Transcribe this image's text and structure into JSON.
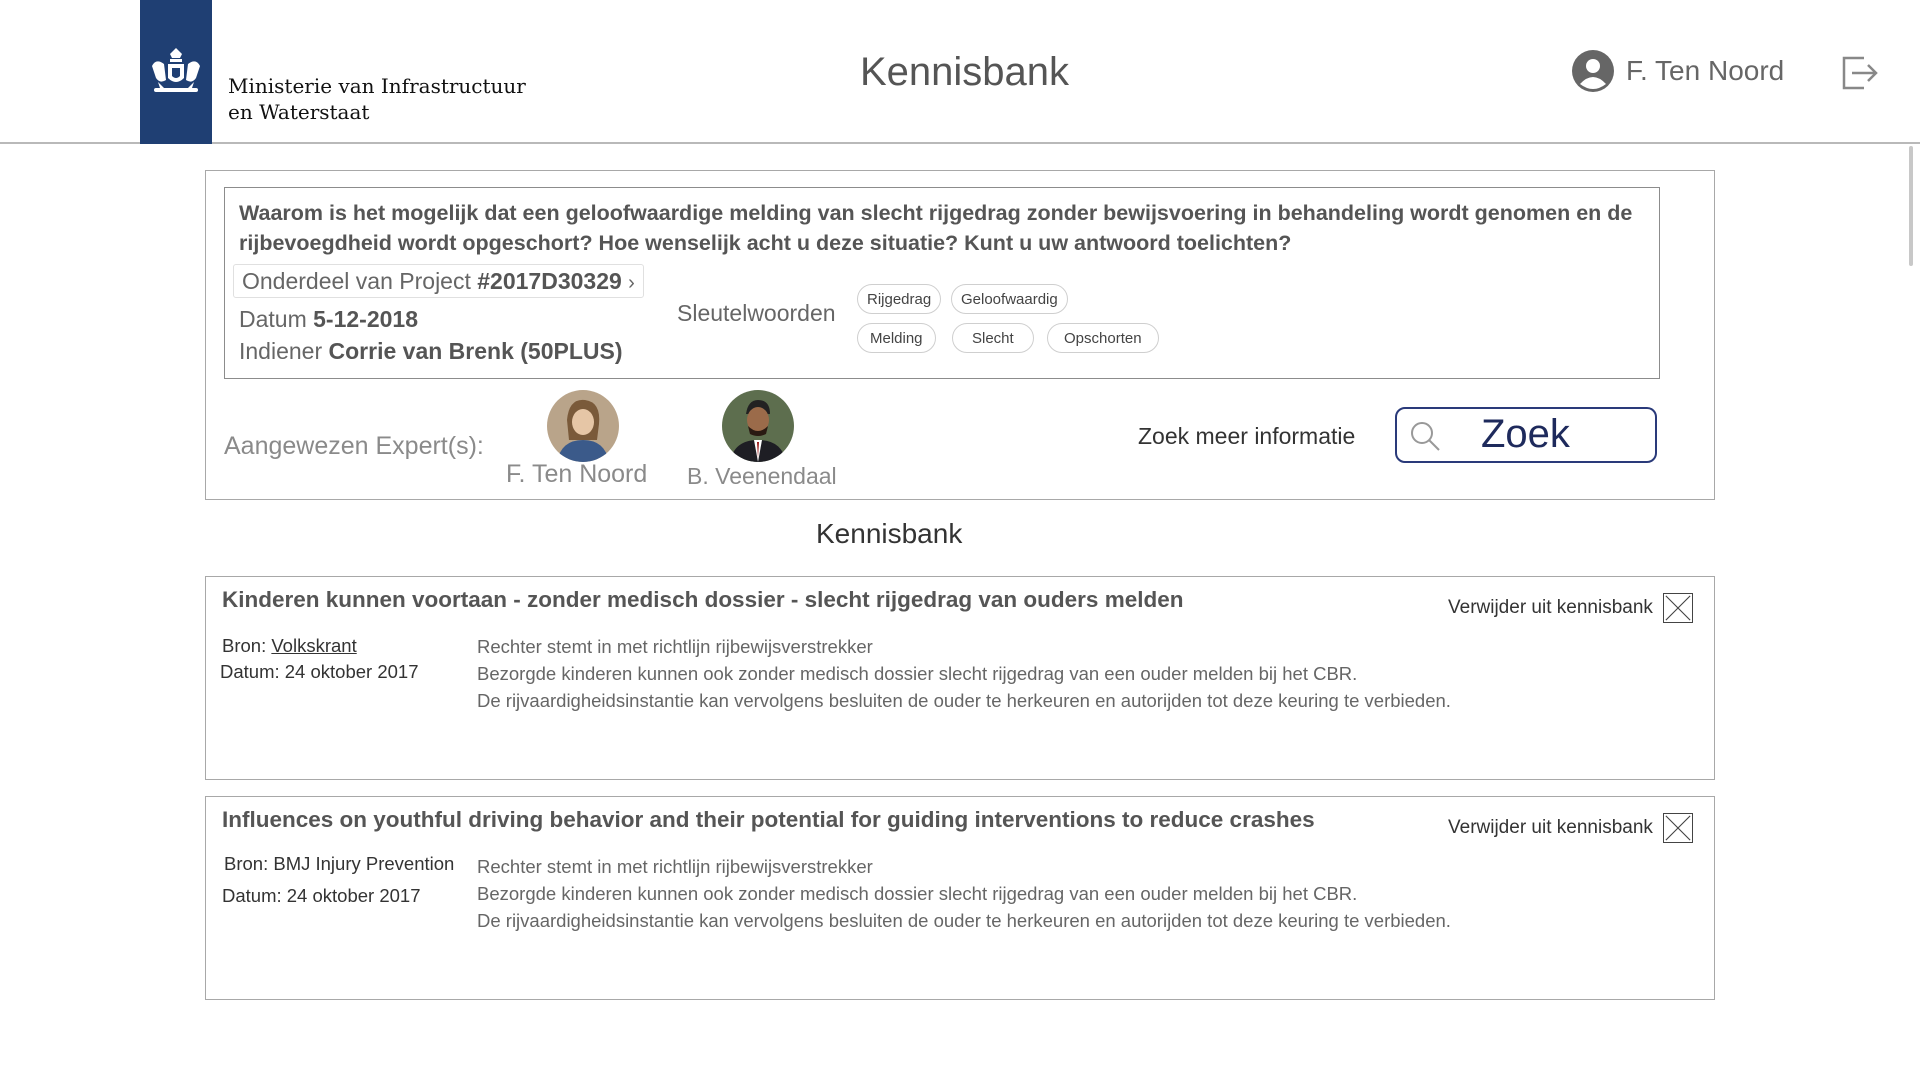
{
  "header": {
    "ministry_line1": "Ministerie van Infrastructuur",
    "ministry_line2": "en Waterstaat",
    "app_title": "Kennisbank",
    "user_name": "F. Ten Noord",
    "brand_color": "#1f3f73"
  },
  "question": {
    "text": "Waarom is het mogelijk dat een geloofwaardige melding van slecht rijgedrag zonder bewijsvoering in behandeling wordt genomen en de rijbevoegdheid wordt opgeschort? Hoe wenselijk acht u deze situatie? Kunt u uw antwoord toelichten?",
    "project_prefix": "Onderdeel van Project",
    "project_number": "#2017D30329",
    "date_label": "Datum",
    "date_value": "5-12-2018",
    "submitter_label": "Indiener",
    "submitter_value": "Corrie van Brenk (50PLUS)",
    "keywords_label": "Sleutelwoorden",
    "keywords": [
      "Rijgedrag",
      "Geloofwaardig",
      "Melding",
      "Slecht",
      "Opschorten"
    ]
  },
  "experts": {
    "label": "Aangewezen Expert(s):",
    "list": [
      {
        "name": "F. Ten Noord"
      },
      {
        "name": "B. Veenendaal"
      }
    ]
  },
  "search": {
    "label": "Zoek meer informatie",
    "button_text": "Zoek"
  },
  "section_title": "Kennisbank",
  "articles": [
    {
      "title": "Kinderen kunnen voortaan - zonder medisch dossier - slecht rijgedrag van ouders melden",
      "remove_label": "Verwijder uit kennisbank",
      "source_label": "Bron:",
      "source": "Volkskrant",
      "date": "Datum: 24 oktober 2017",
      "body_line1": "Rechter stemt in met richtlijn rijbewijsverstrekker",
      "body_line2": "Bezorgde kinderen kunnen ook zonder medisch dossier slecht rijgedrag van een ouder melden bij het CBR.",
      "body_line3": "De rijvaardigheidsinstantie kan vervolgens besluiten de ouder te herkeuren en autorijden tot deze keuring te verbieden."
    },
    {
      "title": "Influences on youthful driving behavior and their potential for guiding interventions to reduce crashes",
      "remove_label": "Verwijder uit kennisbank",
      "source_label": "Bron:",
      "source": "BMJ Injury Prevention",
      "date": "Datum: 24 oktober 2017",
      "body_line1": "Rechter stemt in met richtlijn rijbewijsverstrekker",
      "body_line2": "Bezorgde kinderen kunnen ook zonder medisch dossier slecht rijgedrag van een ouder melden bij het CBR.",
      "body_line3": "De rijvaardigheidsinstantie kan vervolgens besluiten de ouder te herkeuren en autorijden tot deze keuring te verbieden."
    }
  ]
}
